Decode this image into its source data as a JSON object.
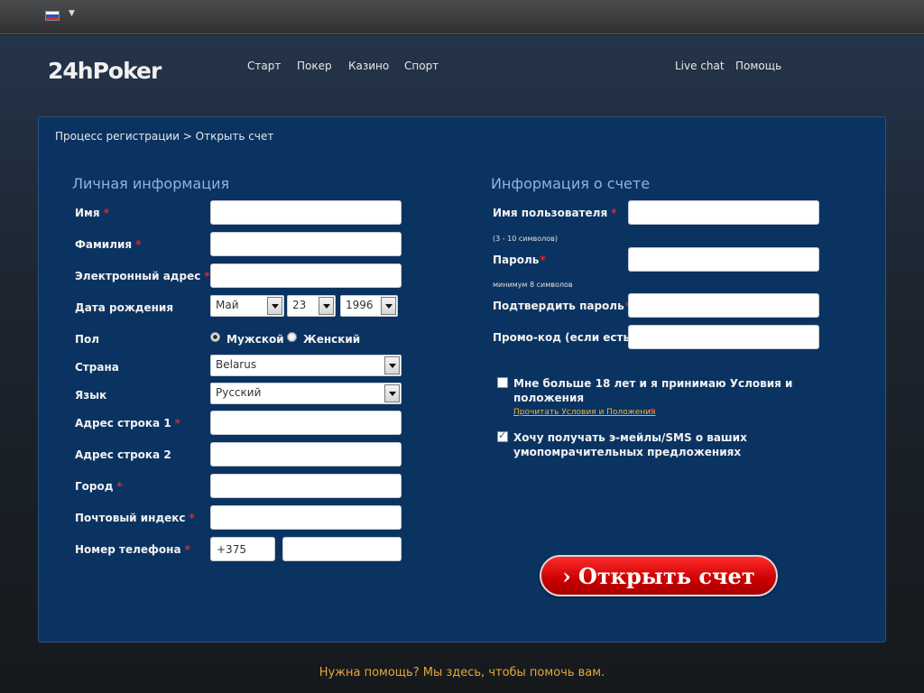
{
  "header": {
    "brand": "24hPoker",
    "language_icon": "russian-flag-icon",
    "nav": {
      "start": "Старт",
      "poker": "Покер",
      "casino": "Казино",
      "sport": "Спорт",
      "live_chat": "Live chat",
      "help": "Помощь"
    }
  },
  "breadcrumb": "Процесс регистрации > Открыть счет",
  "personal": {
    "title": "Личная информация",
    "first_name": "Имя",
    "last_name": "Фамилия",
    "email": "Электронный адрес",
    "dob": "Дата рождения",
    "dob_month": "Май",
    "dob_day": "23",
    "dob_year": "1996",
    "gender": "Пол",
    "gender_male": "Мужской",
    "gender_female": "Женский",
    "gender_selected": "Мужской",
    "country": "Страна",
    "country_value": "Belarus",
    "language": "Язык",
    "language_value": "Русский",
    "address1": "Адрес строка 1",
    "address2": "Адрес строка 2",
    "city": "Город",
    "postal": "Почтовый индекс",
    "phone": "Номер телефона",
    "phone_code": "+375"
  },
  "account": {
    "title": "Информация о счете",
    "username": "Имя пользователя",
    "username_hint": "(3 - 10 символов)",
    "password": "Пароль",
    "password_hint": "минимум 8 символов",
    "confirm_password": "Подтвердить пароль",
    "promo": "Промо-код (если есть)",
    "terms_line1": "Мне больше 18 лет и я принимаю Условия и",
    "terms_line2": "положения",
    "terms_link": "Прочитать Условия и Положения",
    "terms_checked": false,
    "marketing_line1": "Хочу получать э-мейлы/SMS о ваших",
    "marketing_line2": "умопомрачительных предложениях",
    "marketing_checked": true
  },
  "required_mark": "*",
  "submit": {
    "chevron": "›",
    "label": "Открыть счет"
  },
  "footer": {
    "help_text": "Нужна помощь? Мы здесь, чтобы помочь вам."
  },
  "colors": {
    "panel_bg": "#0b3361",
    "section_title": "#8fb4dc",
    "required": "#e0262b",
    "cta_red": "#d40000",
    "link_orange": "#e8b53a"
  }
}
